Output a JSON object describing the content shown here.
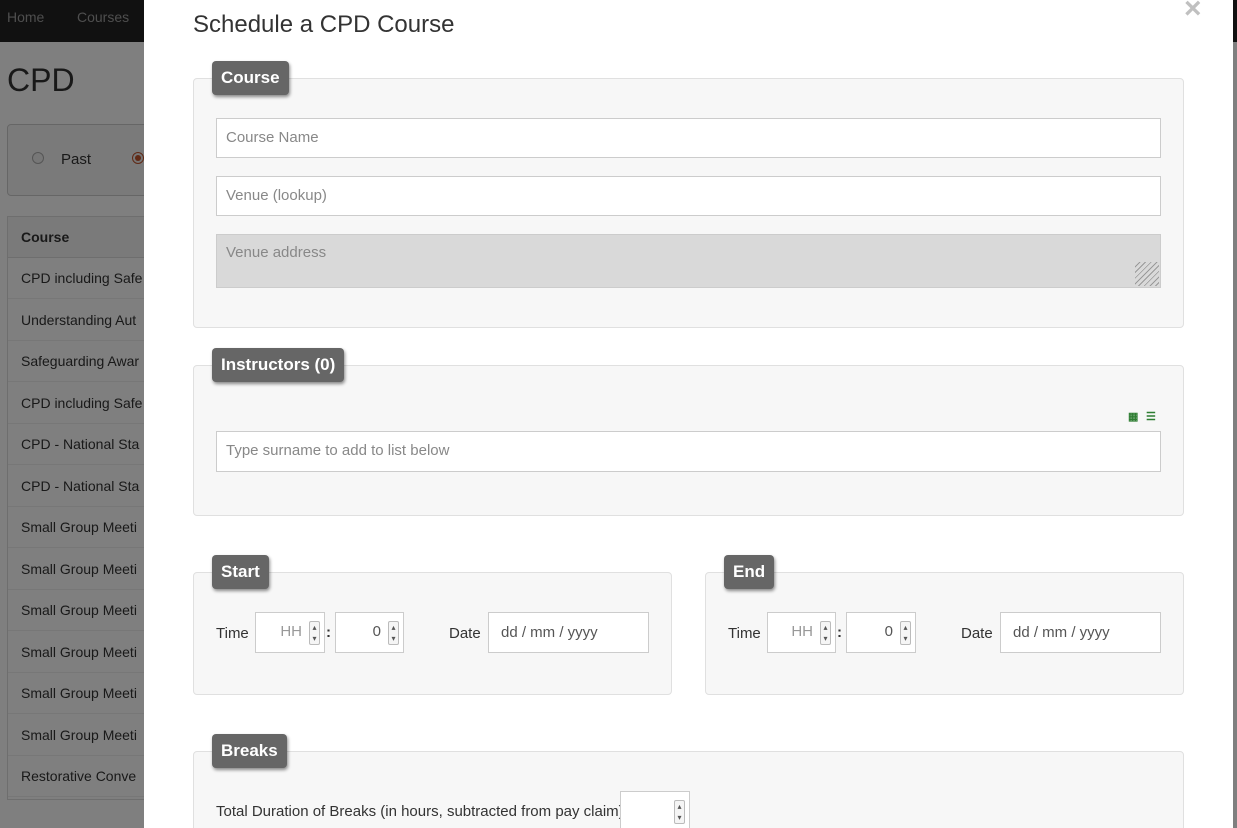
{
  "background": {
    "nav": [
      "Home",
      "Courses"
    ],
    "page_title": "CPD",
    "radios": [
      {
        "label": "Past",
        "checked": false
      },
      {
        "label": "",
        "checked": true
      }
    ],
    "table": {
      "header": "Course",
      "rows": [
        "CPD including Safe",
        "Understanding Aut",
        "Safeguarding Awar",
        "CPD including Safe",
        "CPD - National Sta",
        "CPD - National Sta",
        "Small Group Meeti",
        "Small Group Meeti",
        "Small Group Meeti",
        "Small Group Meeti",
        "Small Group Meeti",
        "Small Group Meeti",
        "Restorative Conve"
      ]
    }
  },
  "modal": {
    "title": "Schedule a CPD Course",
    "close_glyph": "×",
    "course": {
      "legend": "Course",
      "course_name_placeholder": "Course Name",
      "venue_placeholder": "Venue (lookup)",
      "venue_address_placeholder": "Venue address"
    },
    "instructors": {
      "legend": "Instructors (0)",
      "icons": [
        "calendar-icon",
        "contact-card-icon"
      ],
      "search_placeholder": "Type surname to add to list below"
    },
    "start": {
      "legend": "Start",
      "time_label": "Time",
      "hour_placeholder": "HH",
      "minute_value": "0",
      "separator": ":",
      "date_label": "Date",
      "date_placeholder": "dd / mm / yyyy"
    },
    "end": {
      "legend": "End",
      "time_label": "Time",
      "hour_placeholder": "HH",
      "minute_value": "0",
      "separator": ":",
      "date_label": "Date",
      "date_placeholder": "dd / mm / yyyy"
    },
    "breaks": {
      "legend": "Breaks",
      "duration_label": "Total Duration of Breaks (in hours, subtracted from pay claim)"
    }
  },
  "colors": {
    "legend_bg": "#666666",
    "overlay": "rgba(0,0,0,0.5)",
    "radio_accent": "#c0522b"
  }
}
